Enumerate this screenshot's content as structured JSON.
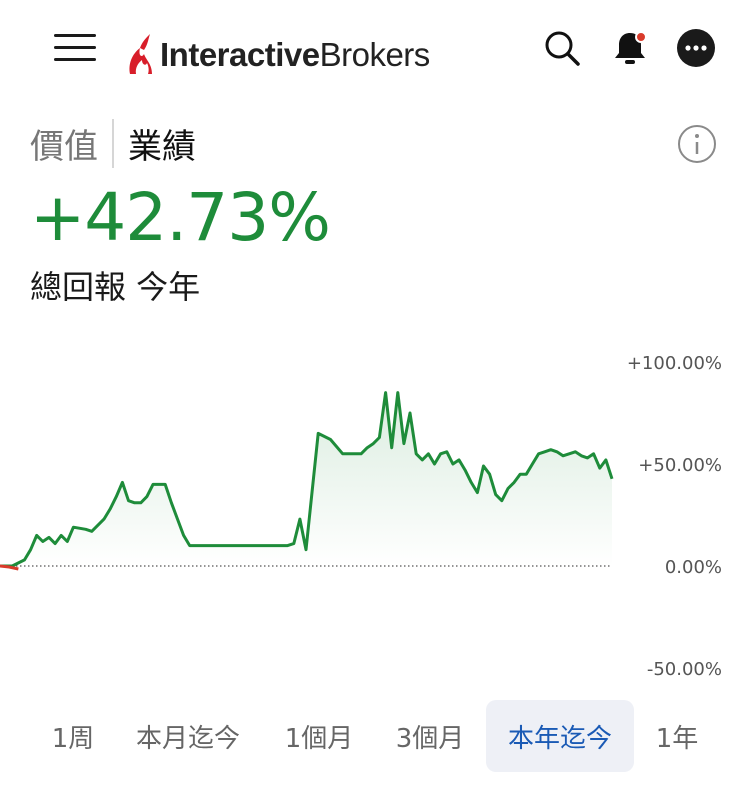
{
  "header": {
    "menu_icon": "hamburger-menu-icon",
    "logo_text_bold": "Interactive",
    "logo_text_regular": "Brokers",
    "search_icon": "search-icon",
    "bell_icon": "notification-bell-icon",
    "more_icon": "more-options-icon"
  },
  "tabs": {
    "items": [
      {
        "label": "價值",
        "active": false
      },
      {
        "label": "業績",
        "active": true
      }
    ],
    "info_icon": "info-icon"
  },
  "summary": {
    "value": "+42.73%",
    "subtitle": "總回報 今年"
  },
  "colors": {
    "positive": "#1e8c3a",
    "negative": "#d93b2b",
    "active_period_text": "#1a5ab5",
    "active_period_bg": "#eef0f6",
    "logo_red": "#d81e2a"
  },
  "chart_data": {
    "type": "area",
    "ylim": [
      -50,
      100
    ],
    "y_ticks": [
      "+100.00%",
      "+50.00%",
      "0.00%",
      "-50.00%"
    ],
    "y_tick_values": [
      100,
      50,
      0,
      -50
    ],
    "baseline": 0,
    "grid": false,
    "series": [
      {
        "x": [
          0,
          2,
          4,
          5,
          6,
          7,
          8,
          9,
          10,
          11,
          12,
          14,
          15,
          16,
          17,
          18,
          19,
          20,
          21,
          22,
          23,
          24,
          25,
          27,
          28,
          29,
          30,
          31,
          32,
          33,
          34,
          35,
          36,
          37,
          38,
          40,
          42,
          44,
          46,
          47,
          48,
          49,
          50,
          52,
          54,
          56,
          58,
          59,
          60,
          61,
          62,
          63,
          64,
          65,
          66,
          67,
          68,
          69,
          70,
          71,
          72,
          73,
          74,
          75,
          76,
          77,
          78,
          79,
          80,
          81,
          82,
          83,
          84,
          85,
          86,
          87,
          88,
          89,
          90,
          91,
          92,
          93,
          94,
          95,
          96,
          97,
          98,
          99,
          100
        ],
        "y": [
          0,
          0,
          3,
          8,
          15,
          12,
          14,
          11,
          15,
          12,
          19,
          18,
          17,
          20,
          23,
          28,
          34,
          41,
          32,
          31,
          31,
          34,
          40,
          40,
          31,
          23,
          15,
          10,
          10,
          10,
          10,
          10,
          10,
          10,
          10,
          10,
          10,
          10,
          10,
          10,
          11,
          23,
          8,
          65,
          62,
          55,
          55,
          55,
          58,
          60,
          63,
          85,
          58,
          85,
          60,
          75,
          55,
          52,
          55,
          50,
          55,
          56,
          50,
          52,
          47,
          41,
          36,
          49,
          45,
          35,
          32,
          38,
          41,
          45,
          45,
          50,
          55,
          56,
          57,
          56,
          54,
          55,
          56,
          54,
          53,
          55,
          48,
          52,
          42.73
        ]
      }
    ]
  },
  "periods": {
    "items": [
      {
        "label": "1周",
        "active": false
      },
      {
        "label": "本月迄今",
        "active": false
      },
      {
        "label": "1個月",
        "active": false
      },
      {
        "label": "3個月",
        "active": false
      },
      {
        "label": "本年迄今",
        "active": true
      },
      {
        "label": "1年",
        "active": false
      }
    ]
  }
}
